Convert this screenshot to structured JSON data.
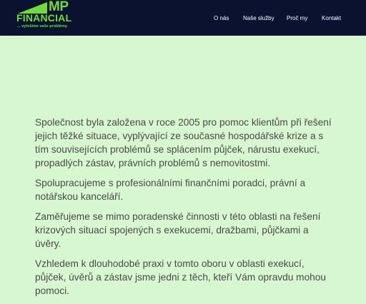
{
  "header": {
    "logo": {
      "mp": "MP",
      "financial": "FINANCIAL",
      "tagline": "... vyřešíme vaše problémy"
    },
    "nav": [
      {
        "label": "O nás"
      },
      {
        "label": "Naše služby"
      },
      {
        "label": "Proč my"
      },
      {
        "label": "Kontakt"
      }
    ]
  },
  "content": {
    "paragraphs": [
      "Společnost byla založena v roce 2005 pro pomoc klientům při řešení jejich těžké situace, vyplývající ze současné hospodářské krize a s tím souvisejících problémů se splácením půjček, nárustu exekucí, propadlých zástav, právních problémů s nemovitostmi.",
      "Spolupracujeme s profesionálními finančními poradci, právní a notářskou kanceláří.",
      "Zaměřujeme se mimo poradenské činnosti v této oblasti na řešení krizových situací spojených s exekucemi, dražbami, půjčkami a úvěry.",
      "Vzhledem k dlouhodobé praxi v tomto oboru v oblasti exekucí, půjček, úvěrů a zástav  jsme jedni z těch, kteří Vám opravdu mohou pomoci."
    ]
  },
  "colors": {
    "header_bg": "#0a1230",
    "page_bg": "#d6f7cf",
    "brand_green": "#6fdc3a",
    "text": "#4a4a4a"
  }
}
